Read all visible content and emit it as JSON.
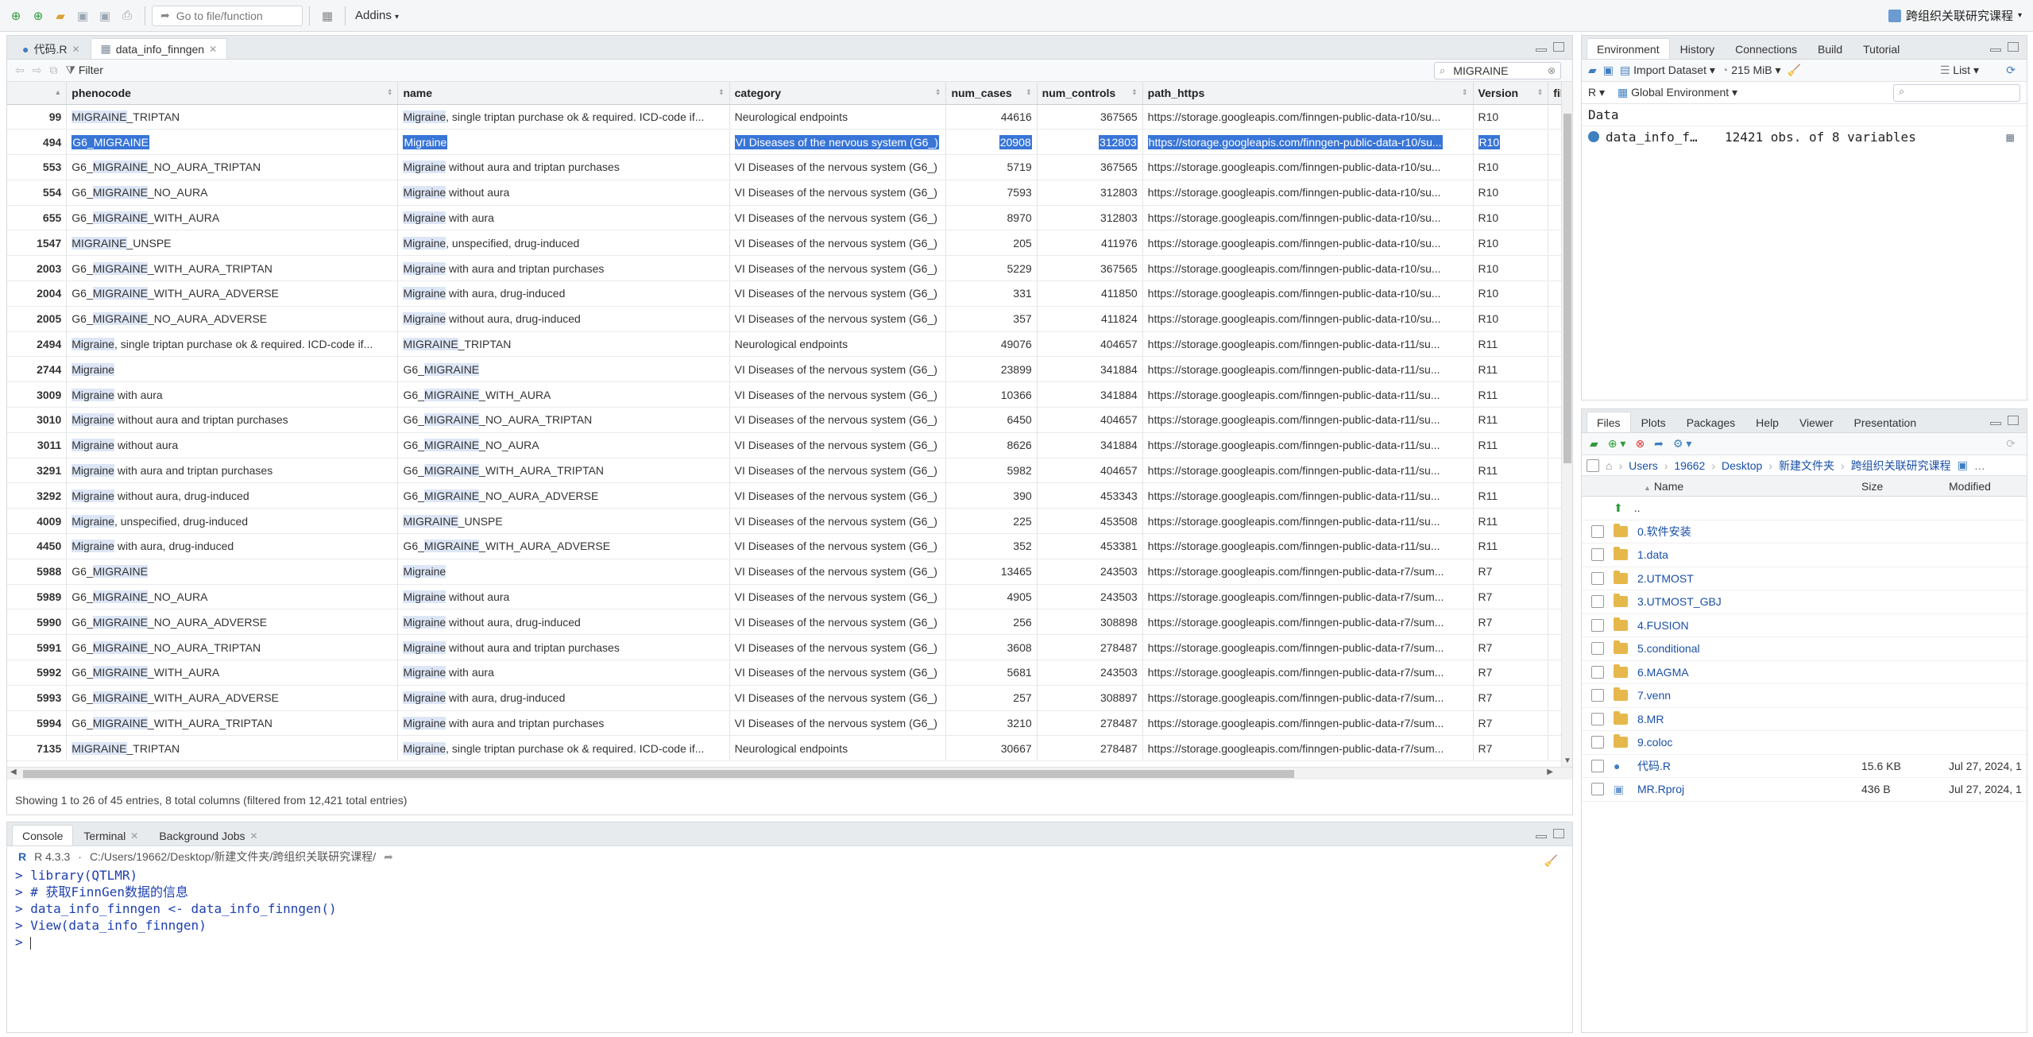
{
  "toolbar": {
    "goto_placeholder": "Go to file/function",
    "addins_label": "Addins",
    "project_name": "跨组织关联研究课程"
  },
  "source_pane": {
    "tabs": [
      {
        "label": "代码.R"
      },
      {
        "label": "data_info_finngen"
      }
    ],
    "filter_label": "Filter",
    "search_value": "MIGRAINE",
    "columns": [
      "phenocode",
      "name",
      "category",
      "num_cases",
      "num_controls",
      "path_https",
      "Version",
      "fil"
    ],
    "rows": [
      [
        "99",
        "MIGRAINE_TRIPTAN",
        "Migraine, single triptan purchase ok & required. ICD-code if...",
        "Neurological endpoints",
        "44616",
        "367565",
        "https://storage.googleapis.com/finngen-public-data-r10/su...",
        "R10"
      ],
      [
        "494",
        "G6_MIGRAINE",
        "Migraine",
        "VI Diseases of the nervous system (G6_)",
        "20908",
        "312803",
        "https://storage.googleapis.com/finngen-public-data-r10/su...",
        "R10"
      ],
      [
        "553",
        "G6_MIGRAINE_NO_AURA_TRIPTAN",
        "Migraine without aura and triptan purchases",
        "VI Diseases of the nervous system (G6_)",
        "5719",
        "367565",
        "https://storage.googleapis.com/finngen-public-data-r10/su...",
        "R10"
      ],
      [
        "554",
        "G6_MIGRAINE_NO_AURA",
        "Migraine without aura",
        "VI Diseases of the nervous system (G6_)",
        "7593",
        "312803",
        "https://storage.googleapis.com/finngen-public-data-r10/su...",
        "R10"
      ],
      [
        "655",
        "G6_MIGRAINE_WITH_AURA",
        "Migraine with aura",
        "VI Diseases of the nervous system (G6_)",
        "8970",
        "312803",
        "https://storage.googleapis.com/finngen-public-data-r10/su...",
        "R10"
      ],
      [
        "1547",
        "MIGRAINE_UNSPE",
        "Migraine, unspecified, drug-induced",
        "VI Diseases of the nervous system (G6_)",
        "205",
        "411976",
        "https://storage.googleapis.com/finngen-public-data-r10/su...",
        "R10"
      ],
      [
        "2003",
        "G6_MIGRAINE_WITH_AURA_TRIPTAN",
        "Migraine with aura and triptan purchases",
        "VI Diseases of the nervous system (G6_)",
        "5229",
        "367565",
        "https://storage.googleapis.com/finngen-public-data-r10/su...",
        "R10"
      ],
      [
        "2004",
        "G6_MIGRAINE_WITH_AURA_ADVERSE",
        "Migraine with aura, drug-induced",
        "VI Diseases of the nervous system (G6_)",
        "331",
        "411850",
        "https://storage.googleapis.com/finngen-public-data-r10/su...",
        "R10"
      ],
      [
        "2005",
        "G6_MIGRAINE_NO_AURA_ADVERSE",
        "Migraine without aura, drug-induced",
        "VI Diseases of the nervous system (G6_)",
        "357",
        "411824",
        "https://storage.googleapis.com/finngen-public-data-r10/su...",
        "R10"
      ],
      [
        "2494",
        "Migraine, single triptan purchase ok & required. ICD-code if...",
        "MIGRAINE_TRIPTAN",
        "Neurological endpoints",
        "49076",
        "404657",
        "https://storage.googleapis.com/finngen-public-data-r11/su...",
        "R11"
      ],
      [
        "2744",
        "Migraine",
        "G6_MIGRAINE",
        "VI Diseases of the nervous system (G6_)",
        "23899",
        "341884",
        "https://storage.googleapis.com/finngen-public-data-r11/su...",
        "R11"
      ],
      [
        "3009",
        "Migraine with aura",
        "G6_MIGRAINE_WITH_AURA",
        "VI Diseases of the nervous system (G6_)",
        "10366",
        "341884",
        "https://storage.googleapis.com/finngen-public-data-r11/su...",
        "R11"
      ],
      [
        "3010",
        "Migraine without aura and triptan purchases",
        "G6_MIGRAINE_NO_AURA_TRIPTAN",
        "VI Diseases of the nervous system (G6_)",
        "6450",
        "404657",
        "https://storage.googleapis.com/finngen-public-data-r11/su...",
        "R11"
      ],
      [
        "3011",
        "Migraine without aura",
        "G6_MIGRAINE_NO_AURA",
        "VI Diseases of the nervous system (G6_)",
        "8626",
        "341884",
        "https://storage.googleapis.com/finngen-public-data-r11/su...",
        "R11"
      ],
      [
        "3291",
        "Migraine with aura and triptan purchases",
        "G6_MIGRAINE_WITH_AURA_TRIPTAN",
        "VI Diseases of the nervous system (G6_)",
        "5982",
        "404657",
        "https://storage.googleapis.com/finngen-public-data-r11/su...",
        "R11"
      ],
      [
        "3292",
        "Migraine without aura, drug-induced",
        "G6_MIGRAINE_NO_AURA_ADVERSE",
        "VI Diseases of the nervous system (G6_)",
        "390",
        "453343",
        "https://storage.googleapis.com/finngen-public-data-r11/su...",
        "R11"
      ],
      [
        "4009",
        "Migraine, unspecified, drug-induced",
        "MIGRAINE_UNSPE",
        "VI Diseases of the nervous system (G6_)",
        "225",
        "453508",
        "https://storage.googleapis.com/finngen-public-data-r11/su...",
        "R11"
      ],
      [
        "4450",
        "Migraine with aura, drug-induced",
        "G6_MIGRAINE_WITH_AURA_ADVERSE",
        "VI Diseases of the nervous system (G6_)",
        "352",
        "453381",
        "https://storage.googleapis.com/finngen-public-data-r11/su...",
        "R11"
      ],
      [
        "5988",
        "G6_MIGRAINE",
        "Migraine",
        "VI Diseases of the nervous system (G6_)",
        "13465",
        "243503",
        "https://storage.googleapis.com/finngen-public-data-r7/sum...",
        "R7"
      ],
      [
        "5989",
        "G6_MIGRAINE_NO_AURA",
        "Migraine without aura",
        "VI Diseases of the nervous system (G6_)",
        "4905",
        "243503",
        "https://storage.googleapis.com/finngen-public-data-r7/sum...",
        "R7"
      ],
      [
        "5990",
        "G6_MIGRAINE_NO_AURA_ADVERSE",
        "Migraine without aura, drug-induced",
        "VI Diseases of the nervous system (G6_)",
        "256",
        "308898",
        "https://storage.googleapis.com/finngen-public-data-r7/sum...",
        "R7"
      ],
      [
        "5991",
        "G6_MIGRAINE_NO_AURA_TRIPTAN",
        "Migraine without aura and triptan purchases",
        "VI Diseases of the nervous system (G6_)",
        "3608",
        "278487",
        "https://storage.googleapis.com/finngen-public-data-r7/sum...",
        "R7"
      ],
      [
        "5992",
        "G6_MIGRAINE_WITH_AURA",
        "Migraine with aura",
        "VI Diseases of the nervous system (G6_)",
        "5681",
        "243503",
        "https://storage.googleapis.com/finngen-public-data-r7/sum...",
        "R7"
      ],
      [
        "5993",
        "G6_MIGRAINE_WITH_AURA_ADVERSE",
        "Migraine with aura, drug-induced",
        "VI Diseases of the nervous system (G6_)",
        "257",
        "308897",
        "https://storage.googleapis.com/finngen-public-data-r7/sum...",
        "R7"
      ],
      [
        "5994",
        "G6_MIGRAINE_WITH_AURA_TRIPTAN",
        "Migraine with aura and triptan purchases",
        "VI Diseases of the nervous system (G6_)",
        "3210",
        "278487",
        "https://storage.googleapis.com/finngen-public-data-r7/sum...",
        "R7"
      ],
      [
        "7135",
        "MIGRAINE_TRIPTAN",
        "Migraine, single triptan purchase ok & required. ICD-code if...",
        "Neurological endpoints",
        "30667",
        "278487",
        "https://storage.googleapis.com/finngen-public-data-r7/sum...",
        "R7"
      ]
    ],
    "selected_row_index": 1,
    "status_text": "Showing 1 to 26 of 45 entries, 8 total columns (filtered from 12,421 total entries)"
  },
  "console_pane": {
    "tabs": [
      {
        "label": "Console"
      },
      {
        "label": "Terminal"
      },
      {
        "label": "Background Jobs"
      }
    ],
    "r_version": "R 4.3.3",
    "path": "C:/Users/19662/Desktop/新建文件夹/跨组织关联研究课程/",
    "lines": [
      "> library(QTLMR)",
      "> # 获取FinnGen数据的信息",
      "> data_info_finngen <- data_info_finngen()",
      "> View(data_info_finngen)",
      "> "
    ]
  },
  "env_pane": {
    "tabs": [
      {
        "label": "Environment"
      },
      {
        "label": "History"
      },
      {
        "label": "Connections"
      },
      {
        "label": "Build"
      },
      {
        "label": "Tutorial"
      }
    ],
    "import_label": "Import Dataset",
    "memory_label": "215 MiB",
    "list_label": "List",
    "lang_label": "R",
    "scope_label": "Global Environment",
    "section_label": "Data",
    "items": [
      {
        "name": "data_info_f…",
        "value": "12421 obs. of 8 variables"
      }
    ]
  },
  "files_pane": {
    "tabs": [
      {
        "label": "Files"
      },
      {
        "label": "Plots"
      },
      {
        "label": "Packages"
      },
      {
        "label": "Help"
      },
      {
        "label": "Viewer"
      },
      {
        "label": "Presentation"
      }
    ],
    "breadcrumb": [
      "Users",
      "19662",
      "Desktop",
      "新建文件夹",
      "跨组织关联研究课程"
    ],
    "columns": {
      "name": "Name",
      "size": "Size",
      "modified": "Modified"
    },
    "parent": "..",
    "folders": [
      "0.软件安装",
      "1.data",
      "2.UTMOST",
      "3.UTMOST_GBJ",
      "4.FUSION",
      "5.conditional",
      "6.MAGMA",
      "7.venn",
      "8.MR",
      "9.coloc"
    ],
    "files": [
      {
        "name": "代码.R",
        "size": "15.6 KB",
        "modified": "Jul 27, 2024, 1"
      },
      {
        "name": "MR.Rproj",
        "size": "436 B",
        "modified": "Jul 27, 2024, 1"
      }
    ]
  }
}
